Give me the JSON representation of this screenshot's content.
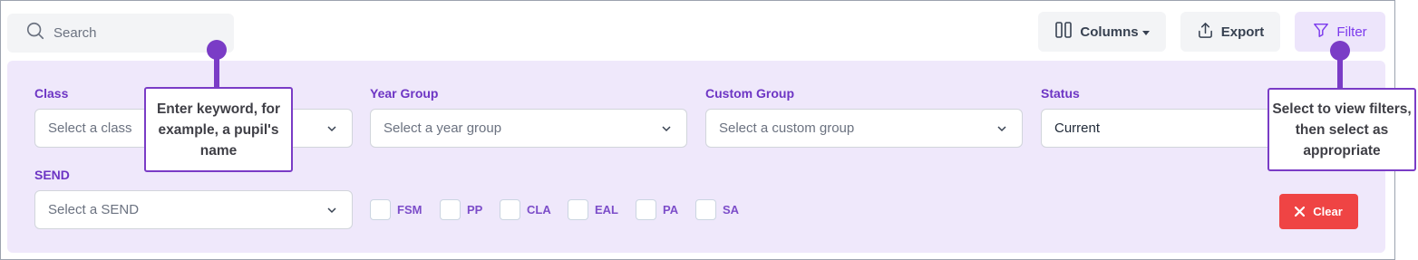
{
  "search": {
    "placeholder": "Search",
    "icon": "search-icon"
  },
  "toolbar": {
    "columns_label": "Columns",
    "export_label": "Export",
    "filter_label": "Filter"
  },
  "filters": {
    "class": {
      "label": "Class",
      "placeholder": "Select a class"
    },
    "year_group": {
      "label": "Year Group",
      "placeholder": "Select a year group"
    },
    "custom_group": {
      "label": "Custom Group",
      "placeholder": "Select a custom group"
    },
    "status": {
      "label": "Status",
      "value": "Current"
    },
    "send": {
      "label": "SEND",
      "placeholder": "Select a SEND"
    },
    "checkboxes": [
      {
        "label": "FSM",
        "checked": false
      },
      {
        "label": "PP",
        "checked": false
      },
      {
        "label": "CLA",
        "checked": false
      },
      {
        "label": "EAL",
        "checked": false
      },
      {
        "label": "PA",
        "checked": false
      },
      {
        "label": "SA",
        "checked": false
      }
    ],
    "clear_label": "Clear"
  },
  "callouts": {
    "search_hint": "Enter keyword, for example, a pupil's name",
    "filter_hint": "Select to view filters, then select as appropriate"
  },
  "colors": {
    "accent": "#7c3aed",
    "callout": "#7a3cc6",
    "panel": "#efe8fb",
    "danger": "#ef4444"
  }
}
